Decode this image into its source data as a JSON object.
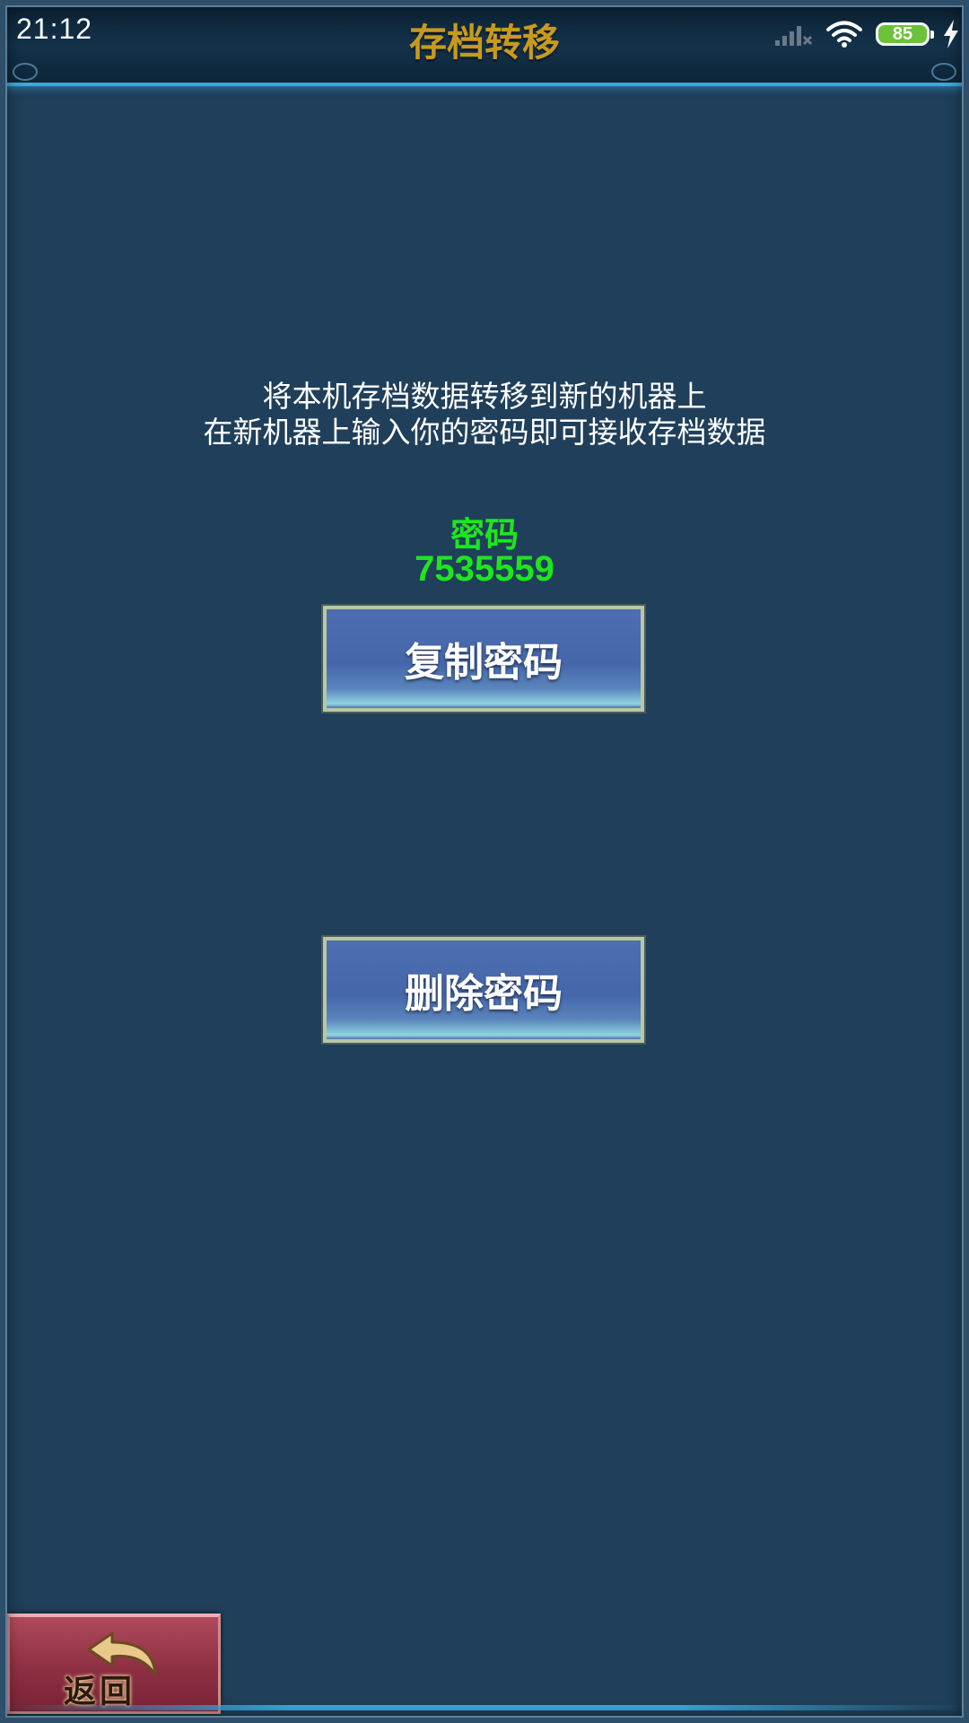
{
  "status_bar": {
    "time": "21:12",
    "battery": "85",
    "icons": [
      "signal-icon",
      "wifi-icon",
      "battery-icon",
      "charging-icon"
    ]
  },
  "header": {
    "title": "存档转移"
  },
  "main": {
    "description_line1": "将本机存档数据转移到新的机器上",
    "description_line2": "在新机器上输入你的密码即可接收存档数据",
    "password_label": "密码",
    "password_value": "7535559",
    "copy_button_label": "复制密码",
    "delete_button_label": "删除密码"
  },
  "footer": {
    "back_label": "返回"
  },
  "colors": {
    "background": "#1f3f5a",
    "title_gold": "#c79a1e",
    "password_green": "#1ee61e",
    "button_blue": "#4567aa",
    "back_button_red": "#8e2f42"
  }
}
